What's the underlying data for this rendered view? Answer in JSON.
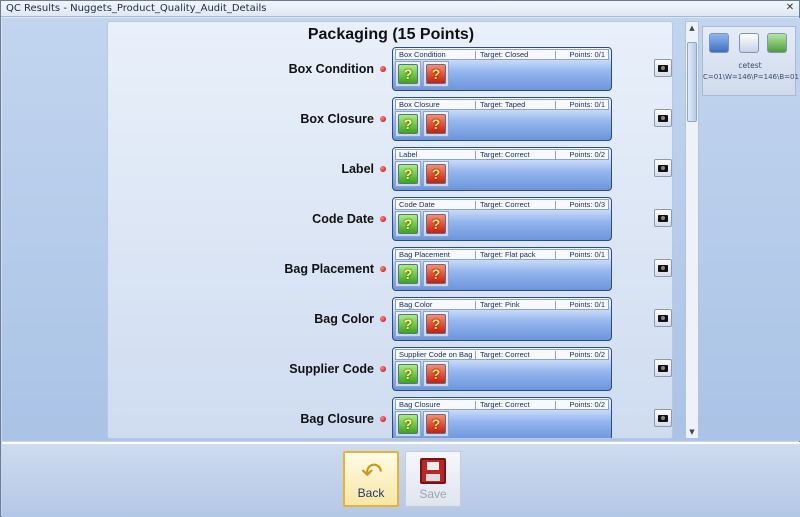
{
  "window": {
    "title": "QC Results - Nuggets_Product_Quality_Audit_Details",
    "close_glyph": "✕"
  },
  "section": {
    "title": "Packaging (15 Points)"
  },
  "rows": [
    {
      "label": "Box Condition",
      "item": "Box Condition",
      "target": "Target: Closed",
      "points": "Points: 0/1",
      "pass_glyph": "?",
      "fail_glyph": "?"
    },
    {
      "label": "Box Closure",
      "item": "Box Closure",
      "target": "Target: Taped",
      "points": "Points: 0/1",
      "pass_glyph": "?",
      "fail_glyph": "?"
    },
    {
      "label": "Label",
      "item": "Label",
      "target": "Target: Correct",
      "points": "Points: 0/2",
      "pass_glyph": "?",
      "fail_glyph": "?"
    },
    {
      "label": "Code Date",
      "item": "Code Date",
      "target": "Target: Correct",
      "points": "Points: 0/3",
      "pass_glyph": "?",
      "fail_glyph": "?"
    },
    {
      "label": "Bag Placement",
      "item": "Bag Placement",
      "target": "Target: Flat pack",
      "points": "Points: 0/1",
      "pass_glyph": "?",
      "fail_glyph": "?"
    },
    {
      "label": "Bag Color",
      "item": "Bag Color",
      "target": "Target: Pink",
      "points": "Points: 0/1",
      "pass_glyph": "?",
      "fail_glyph": "?"
    },
    {
      "label": "Supplier Code",
      "item": "Supplier Code on Bag",
      "target": "Target: Correct",
      "points": "Points: 0/2",
      "pass_glyph": "?",
      "fail_glyph": "?"
    },
    {
      "label": "Bag Closure",
      "item": "Bag Closure",
      "target": "Target: Correct",
      "points": "Points: 0/2",
      "pass_glyph": "?",
      "fail_glyph": "?"
    }
  ],
  "side_panel": {
    "user": "cetest",
    "info": "C=01\\W=146\\P=146\\B=01"
  },
  "scrollbar": {
    "up_glyph": "▲",
    "down_glyph": "▼"
  },
  "footer": {
    "back_label": "Back",
    "back_icon": "↶",
    "save_label": "Save"
  },
  "colors": {
    "pass_button": "#3ea41a",
    "fail_button": "#c8200a",
    "accent_border": "#e4b43a"
  }
}
